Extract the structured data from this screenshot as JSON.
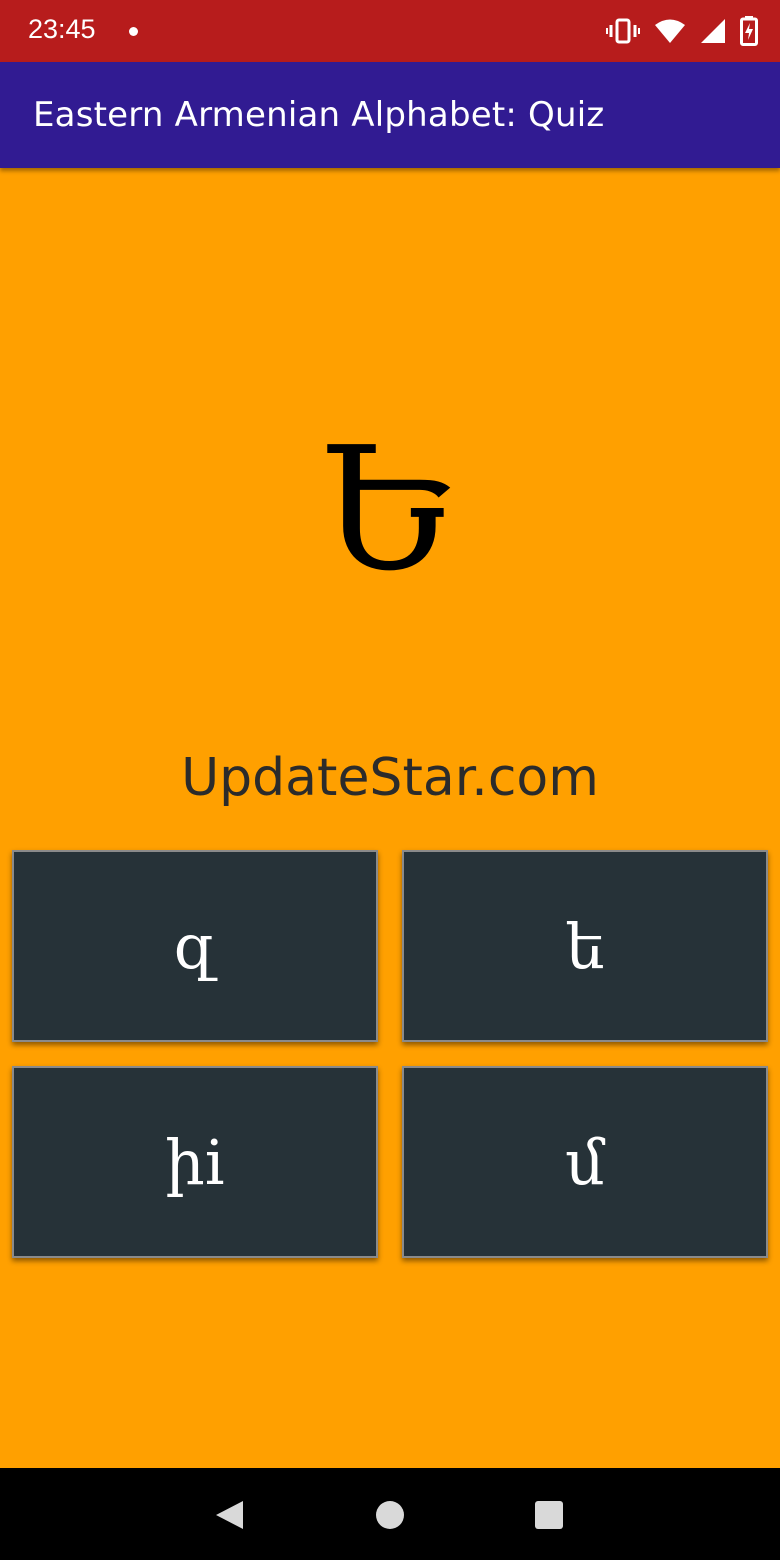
{
  "status_bar": {
    "time": "23:45",
    "icons": [
      "notification-dot",
      "vibrate-icon",
      "wifi-icon",
      "signal-icon",
      "battery-charging-icon"
    ],
    "color": "#B71C1C"
  },
  "app_bar": {
    "title": "Eastern Armenian Alphabet: Quiz",
    "color": "#311B92"
  },
  "quiz": {
    "question_letter": "Ե",
    "watermark": "UpdateStar.com",
    "background": "#FFA000",
    "answers": [
      {
        "label": "զ"
      },
      {
        "label": "ե"
      },
      {
        "label": "իi"
      },
      {
        "label": "մ"
      }
    ],
    "answer_color": "#263238"
  },
  "nav_bar": {
    "buttons": [
      "back-icon",
      "home-icon",
      "recents-icon"
    ]
  }
}
